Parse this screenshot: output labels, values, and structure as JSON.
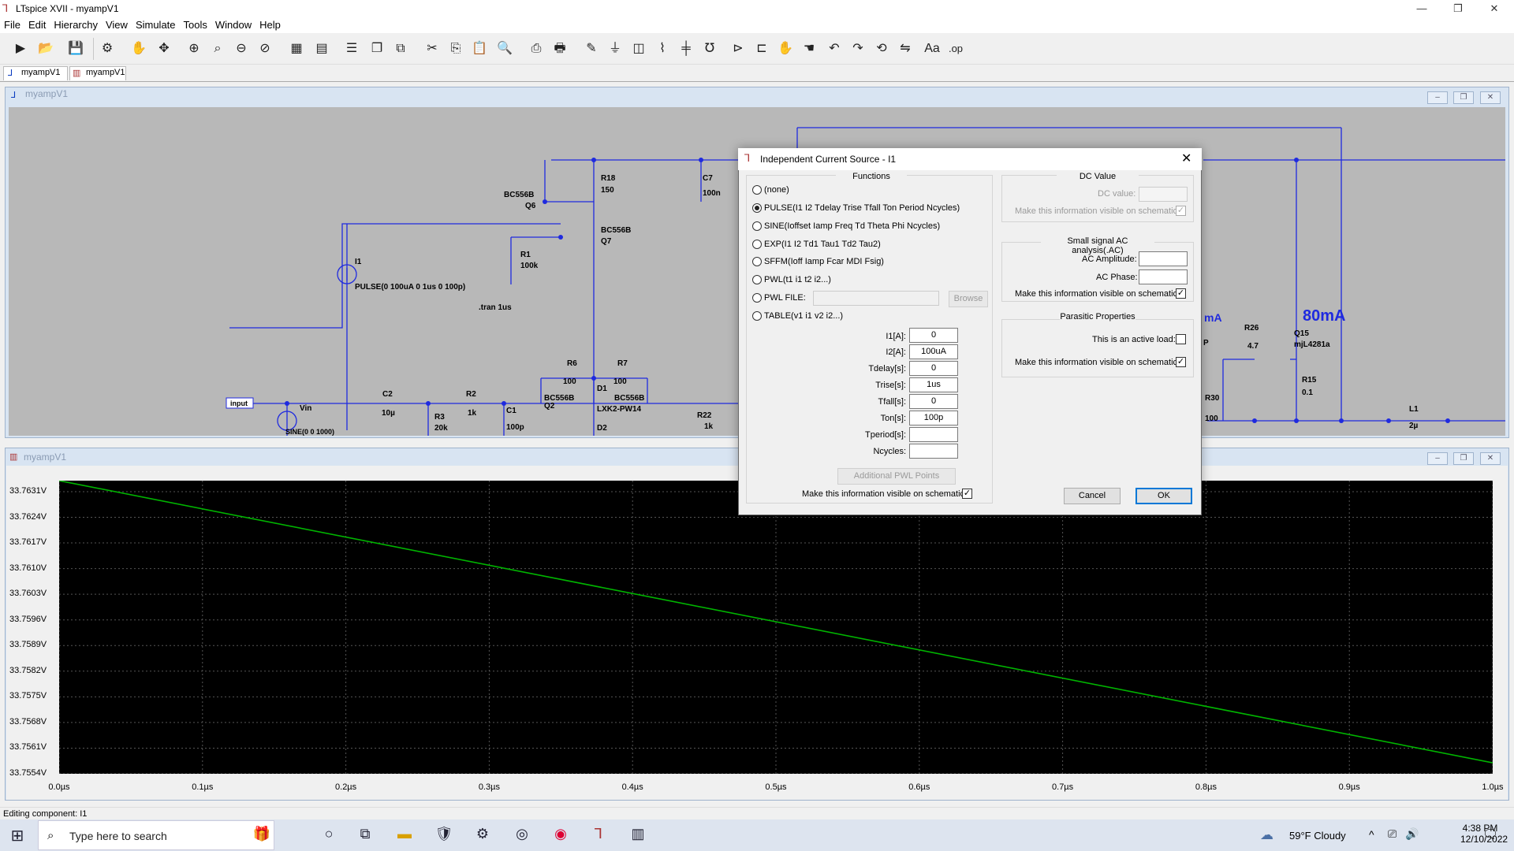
{
  "app": {
    "title": "LTspice XVII - myampV1"
  },
  "window_controls": {
    "minimize": "—",
    "restore": "❐",
    "close": "✕"
  },
  "menu": [
    "File",
    "Edit",
    "Hierarchy",
    "View",
    "Simulate",
    "Tools",
    "Window",
    "Help"
  ],
  "tabs": [
    {
      "label": "myampV1"
    },
    {
      "label": "myampV1"
    }
  ],
  "schematic": {
    "window_title": "myampV1",
    "labels": {
      "q6_model": "BC556B",
      "q6": "Q6",
      "r18": "R18",
      "r18_val": "150",
      "c7": "C7",
      "c7_val": "100n",
      "q7_model": "BC556B",
      "q7": "Q7",
      "r1": "R1",
      "r1_val": "100k",
      "i1": "I1",
      "i1_val": "PULSE(0 100uA 0 1us 0 100p)",
      "tran": ".tran 1us",
      "input": "input",
      "vin": "Vin",
      "vin_val": "SINE(0 0 1000)",
      "c2": "C2",
      "c2_val": "10µ",
      "r3": "R3",
      "r3_val": "20k",
      "r2": "R2",
      "r2_val": "1k",
      "c1": "C1",
      "c1_val": "100p",
      "r6": "R6",
      "r6_val": "100",
      "r7": "R7",
      "r7_val": "100",
      "q2_model": "BC556B",
      "q2": "Q2",
      "d1": "D1",
      "d1_model": "LXK2-PW14",
      "q3_model": "BC556B",
      "d2": "D2",
      "r22": "R22",
      "r22_val": "1k",
      "amA": "mA",
      "big_current": "80mA",
      "r26": "R26",
      "r26_val": "4.7",
      "q15": "Q15",
      "q15_model": "mjL4281a",
      "r15": "R15",
      "r15_val": "0.1",
      "r30": "R30",
      "r30_val": "100",
      "l1": "L1",
      "l1_val": "2µ",
      "p_frag": "P"
    }
  },
  "waveform": {
    "window_title": "myampV1",
    "y_ticks": [
      "33.7631V",
      "33.7624V",
      "33.7617V",
      "33.7610V",
      "33.7603V",
      "33.7596V",
      "33.7589V",
      "33.7582V",
      "33.7575V",
      "33.7568V",
      "33.7561V",
      "33.7554V"
    ],
    "x_ticks": [
      "0.0µs",
      "0.1µs",
      "0.2µs",
      "0.3µs",
      "0.4µs",
      "0.5µs",
      "0.6µs",
      "0.7µs",
      "0.8µs",
      "0.9µs",
      "1.0µs"
    ],
    "trace_color": "#00b400"
  },
  "chart_data": {
    "type": "line",
    "x": [
      0.0,
      1.0
    ],
    "y": [
      33.7634,
      33.7557
    ],
    "xlim": [
      0.0,
      1.0
    ],
    "ylim": [
      33.7554,
      33.7634
    ],
    "grid": true
  },
  "dialog": {
    "title": "Independent Current Source - I1",
    "functions_label": "Functions",
    "functions": [
      {
        "label": "(none)",
        "selected": false
      },
      {
        "label": "PULSE(I1 I2 Tdelay Trise Tfall Ton Period Ncycles)",
        "selected": true
      },
      {
        "label": "SINE(Ioffset Iamp Freq Td Theta Phi Ncycles)",
        "selected": false
      },
      {
        "label": "EXP(I1 I2 Td1 Tau1 Td2 Tau2)",
        "selected": false
      },
      {
        "label": "SFFM(Ioff Iamp Fcar MDI Fsig)",
        "selected": false
      },
      {
        "label": "PWL(t1 i1 t2 i2...)",
        "selected": false
      },
      {
        "label": "PWL FILE:",
        "selected": false
      },
      {
        "label": "TABLE(v1 i1 v2 i2...)",
        "selected": false
      }
    ],
    "browse_label": "Browse",
    "params": [
      {
        "label": "I1[A]:",
        "value": "0"
      },
      {
        "label": "I2[A]:",
        "value": "100uA"
      },
      {
        "label": "Tdelay[s]:",
        "value": "0"
      },
      {
        "label": "Trise[s]:",
        "value": "1us"
      },
      {
        "label": "Tfall[s]:",
        "value": "0"
      },
      {
        "label": "Ton[s]:",
        "value": "100p"
      },
      {
        "label": "Tperiod[s]:",
        "value": ""
      },
      {
        "label": "Ncycles:",
        "value": ""
      }
    ],
    "pwl_button": "Additional PWL Points",
    "visible_label": "Make this information visible on schematic:",
    "dc": {
      "group": "DC Value",
      "label": "DC value:",
      "value": "",
      "visible_label": "Make this information visible on schematic:"
    },
    "ac": {
      "group": "Small signal AC analysis(.AC)",
      "amp_label": "AC Amplitude:",
      "amp_value": "",
      "phase_label": "AC Phase:",
      "phase_value": "",
      "visible_label": "Make this information visible on schematic:"
    },
    "parasitic": {
      "group": "Parasitic Properties",
      "active_label": "This is an active load:",
      "visible_label": "Make this information visible on schematic:"
    },
    "cancel": "Cancel",
    "ok": "OK",
    "close": "✕",
    "check": "✓"
  },
  "status": {
    "text": "Editing component: I1"
  },
  "taskbar": {
    "start": "⊞",
    "search_placeholder": "Type here to search",
    "weather": "59°F  Cloudy",
    "time": "4:38 PM",
    "date": "12/10/2022",
    "tray_arrow": "^"
  }
}
